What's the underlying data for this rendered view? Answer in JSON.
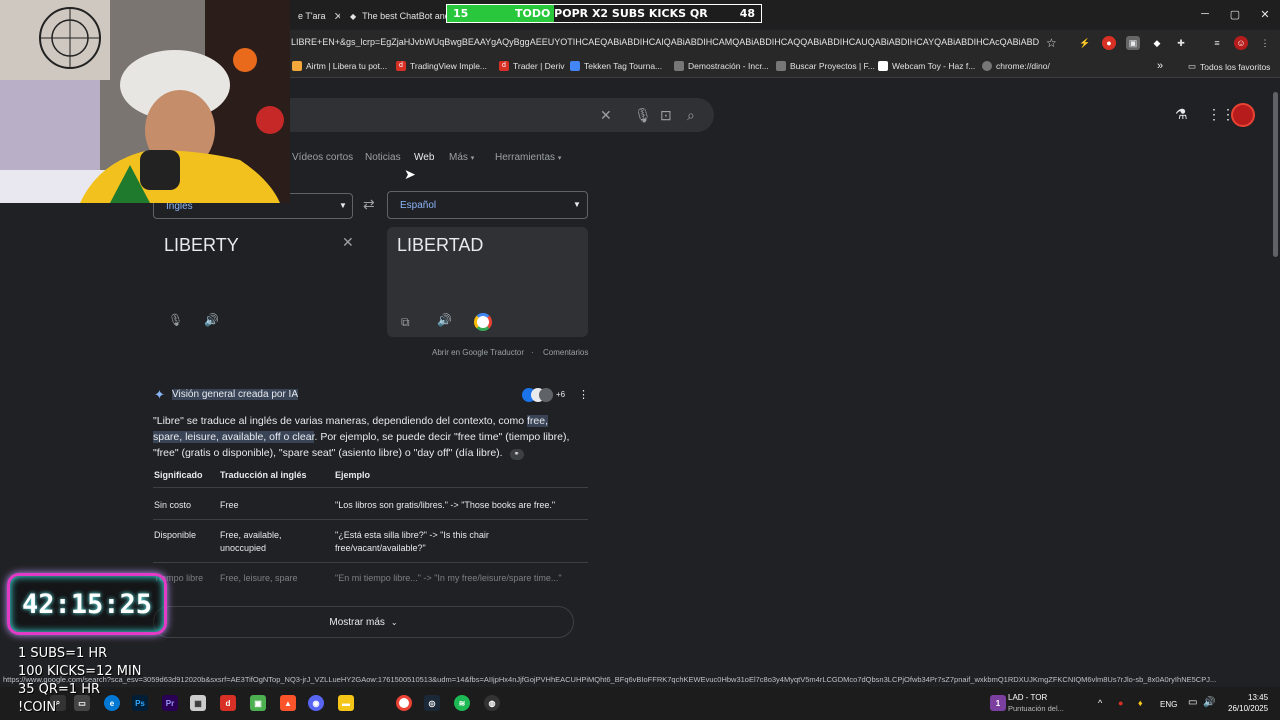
{
  "browser": {
    "tabs": [
      {
        "title": "e T'ara"
      },
      {
        "title": "The best ChatBot and"
      }
    ],
    "url": "LIBRE+EN+&gs_lcrp=EgZjaHJvbWUqBwgBEAAYgAQyBggAEEUYOTIHCAEQABiABDIHCAIQABiABDIHCAMQABiABDIHCAQQABiABDIHCAUQABiABDIHCAYQABiABDIHCAcQABiABDIHC...",
    "bookmarks": [
      {
        "label": "Airtm | Libera tu pot...",
        "color": "#f2a83b"
      },
      {
        "label": "TradingView Imple...",
        "color": "#d93025"
      },
      {
        "label": "Trader | Deriv",
        "color": "#d93025"
      },
      {
        "label": "Tekken Tag Tourna...",
        "color": "#4285f4"
      },
      {
        "label": "Demostración - Incr...",
        "color": "#777777"
      },
      {
        "label": "Buscar Proyectos | F...",
        "color": "#777777"
      },
      {
        "label": "Webcam Toy - Haz f...",
        "color": "#ffffff"
      },
      {
        "label": "chrome://dino/",
        "color": "#777777"
      }
    ],
    "all_favorites": "Todos los favoritos"
  },
  "overlay_bar": {
    "left": "15",
    "center": "TODO POPR X2 SUBS KICKS QR",
    "right": "48",
    "progress": 0.34
  },
  "search_nav": {
    "items": [
      "Vídeos cortos",
      "Noticias",
      "Web",
      "Más",
      "Herramientas"
    ],
    "active": "Web"
  },
  "translator": {
    "source_lang": "Inglés",
    "target_lang": "Español",
    "source_text": "LIBERTY",
    "target_text": "LIBERTAD",
    "open_link": "Abrir en Google Traductor",
    "comments": "Comentarios"
  },
  "ai_overview": {
    "title": "Visión general creada por IA",
    "source_count": "+6",
    "p_start": "\"Libre\" se traduce al inglés de varias maneras, dependiendo del contexto, como ",
    "p_hl1": "free,",
    "p_hl2": "spare, leisure, available, off o clear",
    "p_rest": ". Por ejemplo, se puede decir \"free time\" (tiempo libre), \"free\" (gratis o disponible), \"spare seat\" (asiento libre) o \"day off\" (día libre).",
    "headers": [
      "Significado",
      "Traducción al inglés",
      "Ejemplo"
    ],
    "rows": [
      [
        "Sin costo",
        "Free",
        "\"Los libros son gratis/libres.\" -> \"Those books are free.\""
      ],
      [
        "Disponible",
        "Free, available, unoccupied",
        "\"¿Está esta silla libre?\" -> \"Is this chair free/vacant/available?\""
      ],
      [
        "Tiempo libre",
        "Free, leisure, spare",
        "\"En mi tiempo libre...\" -> \"In my free/leisure/spare time...\""
      ]
    ],
    "show_more": "Mostrar más"
  },
  "status_url": "https://www.google.com/search?sca_esv=3059d63d912020b&sxsrf=AE3TifOgNTop_NQ3-jrJ_VZLLueHY2GAow:1761500510513&udm=14&fbs=AIIjpHx4nJjfGojPVHhEACUHPiMQht6_BFq6vBIoFFRK7qchKEWEvuc0Hbw31oEl7c8o3y4MyqtV5m4rLCGDMco7dQbsn3LCPjOfwb34Pr7sZ7pnaif_wxkbmQ1RDXUJKmgZFKCNIQM6vlm8Us7rJlo-sb_8x0A0ryIhNE5CPJ...",
  "stream": {
    "timer": "42:15:25",
    "promo": [
      "1 SUBS=1 HR",
      "100 KICKS=12 MIN",
      "35 QR=1 HR",
      "!COIN"
    ]
  },
  "taskbar": {
    "match_title": "LAD - TOR",
    "match_sub": "Puntuación del...",
    "lang": "ENG",
    "time": "13:45",
    "date": "26/10/2025"
  }
}
